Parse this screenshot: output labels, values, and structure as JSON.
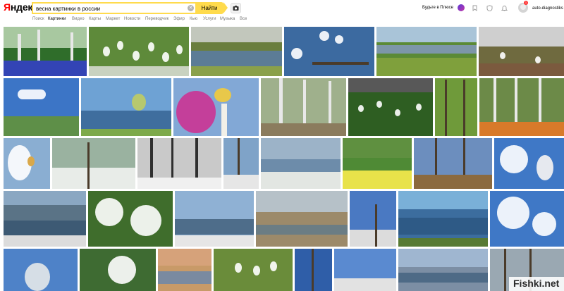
{
  "header": {
    "logo_first_letter": "Я",
    "logo_rest": "ндекс",
    "search": {
      "value": "весна картинки в россии",
      "placeholder": ""
    },
    "clear_icon": "close-icon",
    "search_button_label": "Найти",
    "camera_icon": "camera-icon",
    "plus_label": "Будьте в Плюсе",
    "user": {
      "name": "auto-diagnostiks",
      "notifications": "1"
    },
    "accent_color": "#ffdb4d",
    "brand_color": "#ff0000"
  },
  "nav": {
    "items": [
      "Поиск",
      "Картинки",
      "Видео",
      "Карты",
      "Маркет",
      "Новости",
      "Переводчик",
      "Эфир",
      "Кью",
      "Услуги",
      "Музыка",
      "Все"
    ],
    "active_index": 1
  },
  "watermark": {
    "text": "Fishki.net"
  }
}
